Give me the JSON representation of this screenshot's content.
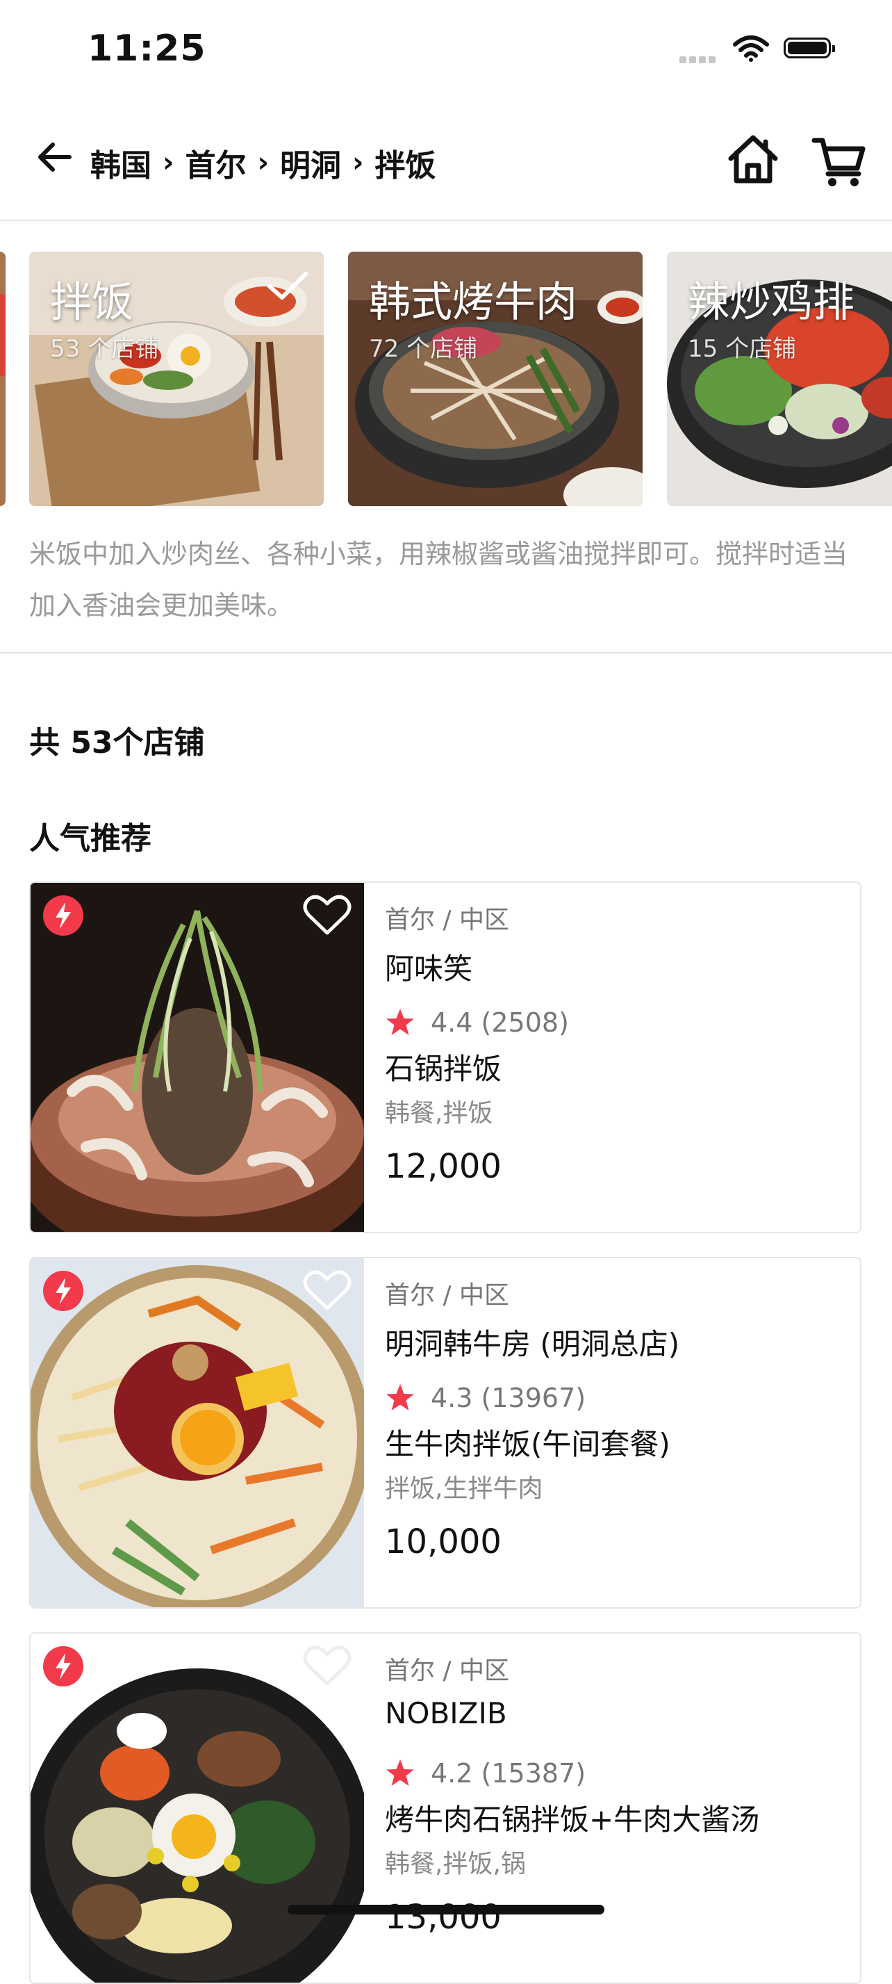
{
  "status_bar": {
    "time": "11:25"
  },
  "nav": {
    "breadcrumb": [
      "韩国",
      "首尔",
      "明洞",
      "拌饭"
    ],
    "separator": "›"
  },
  "categories": [
    {
      "label": "拌饭",
      "count": "53 个店铺",
      "selected": true
    },
    {
      "label": "韩式烤牛肉",
      "count": "72 个店铺",
      "selected": false
    },
    {
      "label": "辣炒鸡排",
      "count": "15 个店铺",
      "selected": false
    }
  ],
  "category_description": "米饭中加入炒肉丝、各种小菜，用辣椒酱或酱油搅拌即可。搅拌时适当加入香油会更加美味。",
  "total_count": "共 53个店铺",
  "section_title": "人气推荐",
  "restaurants": [
    {
      "location": "首尔 / 中区",
      "name": "阿味笑",
      "rating": "4.4",
      "reviews": "(2508)",
      "dish": "石锅拌饭",
      "tags": "韩餐,拌饭",
      "price": "12,000",
      "favorited": false
    },
    {
      "location": "首尔 / 中区",
      "name": "明洞韩牛房 (明洞总店)",
      "rating": "4.3",
      "reviews": "(13967)",
      "dish": "生牛肉拌饭(午间套餐)",
      "tags": "拌饭,生拌牛肉",
      "price": "10,000",
      "favorited": false
    },
    {
      "location": "首尔 / 中区",
      "name": "NOBIZIB",
      "rating": "4.2",
      "reviews": "(15387)",
      "dish": "烤牛肉石锅拌饭+牛肉大酱汤",
      "tags": "韩餐,拌饭,锅",
      "price": "13,000",
      "favorited": false
    }
  ],
  "colors": {
    "accent": "#f23a4b",
    "divider": "#e4e4e4",
    "muted_text": "#9a9a9a"
  },
  "icons": [
    "back-arrow-icon",
    "home-icon",
    "cart-icon",
    "check-icon",
    "lightning-icon",
    "heart-icon",
    "star-icon",
    "wifi-icon",
    "battery-icon",
    "signal-icon"
  ]
}
